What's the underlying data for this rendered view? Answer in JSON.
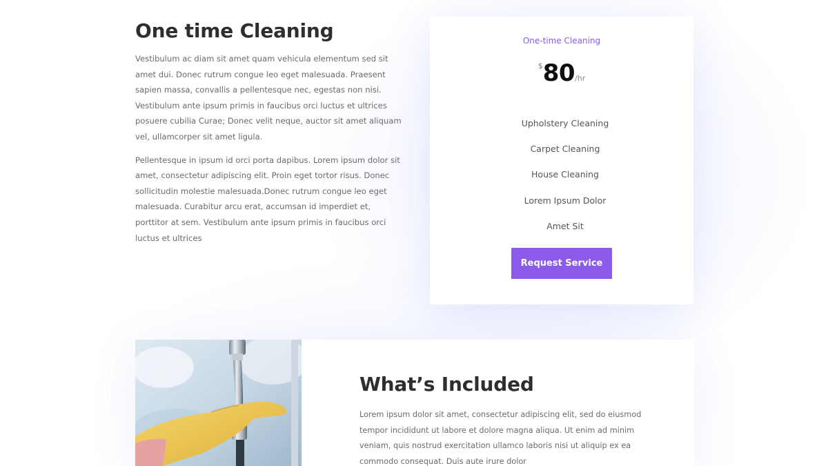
{
  "intro": {
    "title": "One time Cleaning",
    "paragraphs": [
      "Vestibulum ac diam sit amet quam vehicula elementum sed sit amet dui. Donec rutrum congue leo eget malesuada. Praesent sapien massa, convallis a pellentesque nec, egestas non nisi. Vestibulum ante ipsum primis in faucibus orci luctus et ultrices posuere cubilia Curae; Donec velit neque, auctor sit amet aliquam vel, ullamcorper sit amet ligula.",
      "Pellentesque in ipsum id orci porta dapibus. Lorem ipsum dolor sit amet, consectetur adipiscing elit. Proin eget tortor risus. Donec sollicitudin molestie malesuada.Donec rutrum congue leo eget malesuada. Curabitur arcu erat, accumsan id imperdiet et, porttitor at sem. Vestibulum ante ipsum primis in faucibus orci luctus et ultrices"
    ]
  },
  "pricing": {
    "plan_name": "One-time Cleaning",
    "currency": "$",
    "amount": "80",
    "unit": "/hr",
    "features": [
      "Upholstery Cleaning",
      "Carpet Cleaning",
      "House Cleaning",
      "Lorem Ipsum Dolor",
      "Amet Sit"
    ],
    "button_label": "Request Service"
  },
  "included": {
    "title": "What’s Included",
    "body": "Lorem ipsum dolor sit amet, consectetur adipiscing elit, sed do eiusmod tempor incididunt ut labore et dolore magna aliqua. Ut enim ad minim veniam, quis nostrud exercitation ullamco laboris nisi ut aliquip ex ea commodo consequat. Duis aute irure dolor"
  },
  "colors": {
    "accent": "#8c5ae8",
    "heading": "#2e2e2e",
    "body_text": "#6b6b6b",
    "glove": "#f0c84a",
    "card_background": "#ffffff"
  },
  "images": {
    "photo_icon": "cleaning-photo-gloved-hand-on-faucet"
  }
}
